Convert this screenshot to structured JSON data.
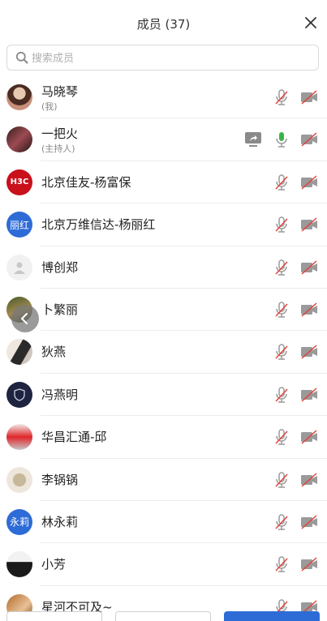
{
  "header": {
    "title": "成员 (37)"
  },
  "search": {
    "placeholder": "搜索成员"
  },
  "members": [
    {
      "name": "马晓琴",
      "subtitle": "(我)",
      "avatar": "photo",
      "mic": "muted",
      "camera": "off"
    },
    {
      "name": "一把火",
      "subtitle": "(主持人)",
      "avatar": "photo",
      "mic": "active",
      "camera": "off",
      "sharing": true
    },
    {
      "name": "北京佳友-杨富保",
      "avatar": "H3C",
      "mic": "muted",
      "camera": "off"
    },
    {
      "name": "北京万维信达-杨丽红",
      "avatar": "丽红",
      "mic": "muted",
      "camera": "off"
    },
    {
      "name": "博创郑",
      "avatar": "default",
      "mic": "muted",
      "camera": "off"
    },
    {
      "name": "卜繁丽",
      "avatar": "photo",
      "mic": "muted",
      "camera": "off"
    },
    {
      "name": "狄燕",
      "avatar": "photo",
      "mic": "muted",
      "camera": "off"
    },
    {
      "name": "冯燕明",
      "avatar": "photo",
      "mic": "muted",
      "camera": "off"
    },
    {
      "name": "华昌汇通-邱",
      "avatar": "photo",
      "mic": "muted",
      "camera": "off"
    },
    {
      "name": "李锅锅",
      "avatar": "photo",
      "mic": "muted",
      "camera": "off"
    },
    {
      "name": "林永莉",
      "avatar": "永莉",
      "mic": "muted",
      "camera": "off"
    },
    {
      "name": "小芳",
      "avatar": "photo",
      "mic": "muted",
      "camera": "off"
    },
    {
      "name": "星河不可及~",
      "avatar": "photo",
      "mic": "muted",
      "camera": "off"
    }
  ],
  "icons": {
    "close": "close-icon",
    "search": "search-icon",
    "mic_muted": "mic-muted-icon",
    "mic_active": "mic-icon",
    "camera_off": "camera-off-icon",
    "screen_share": "screen-share-icon",
    "back": "chevron-left-icon"
  },
  "colors": {
    "accent": "#2d6bd7",
    "mic_active": "#3bb54a",
    "muted_slash": "#e0443d",
    "icon_gray": "#9a9a9a"
  }
}
